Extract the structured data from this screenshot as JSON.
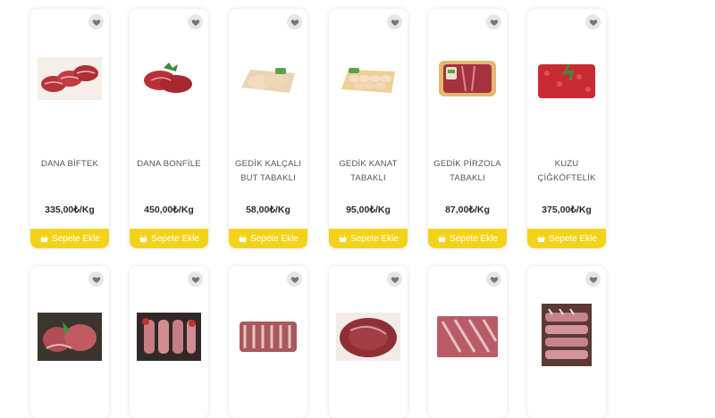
{
  "colors": {
    "accent": "#f3d31a",
    "heart_bg": "#e6e6e6",
    "heart": "#777777"
  },
  "icons": {
    "favorite": "heart-icon",
    "cart": "basket-icon"
  },
  "row1": [
    {
      "name": "DANA BİFTEK",
      "name2": "",
      "price": "335,00₺/Kg",
      "button": "Sepete Ekle"
    },
    {
      "name": "DANA BONFİLE",
      "name2": "",
      "price": "450,00₺/Kg",
      "button": "Sepete Ekle"
    },
    {
      "name": "GEDİK KALÇALI",
      "name2": "BUT TABAKLI",
      "price": "58,00₺/Kg",
      "button": "Sepete Ekle"
    },
    {
      "name": "GEDİK KANAT",
      "name2": "TABAKLI",
      "price": "95,00₺/Kg",
      "button": "Sepete Ekle"
    },
    {
      "name": "GEDİK PİRZOLA",
      "name2": "TABAKLI",
      "price": "87,00₺/Kg",
      "button": "Sepete Ekle"
    },
    {
      "name": "KUZU",
      "name2": "ÇİĞKÖFTELİK",
      "price": "375,00₺/Kg",
      "button": "Sepete Ekle"
    }
  ]
}
